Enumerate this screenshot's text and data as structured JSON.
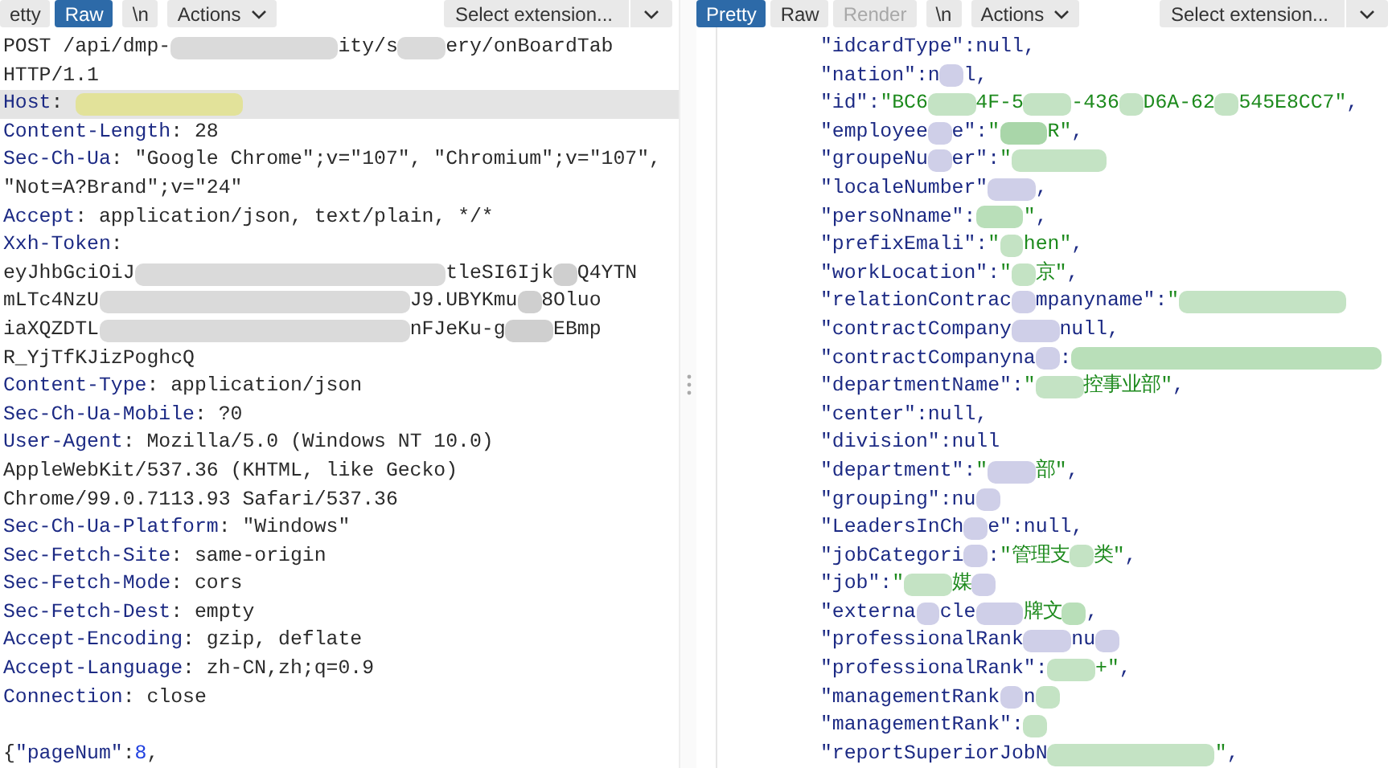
{
  "request": {
    "toolbar": [
      {
        "kind": "tab",
        "label": "etty",
        "selected": false,
        "disabled": false
      },
      {
        "kind": "tab",
        "label": "Raw",
        "selected": true,
        "disabled": false
      },
      {
        "kind": "toggle",
        "label": "\\n"
      },
      {
        "kind": "menu",
        "label": "Actions"
      }
    ],
    "extension_select": {
      "placeholder": "Select extension..."
    },
    "lines": [
      {
        "highlighted": false,
        "parts": [
          {
            "kind": "text",
            "text": "POST /api/dmp-"
          },
          {
            "kind": "blur_xl",
            "color": "#dadada"
          },
          {
            "kind": "text",
            "text": "ity/s"
          },
          {
            "kind": "blur_m",
            "color": "#dadada"
          },
          {
            "kind": "text",
            "text": "ery/onBoardTab"
          }
        ]
      },
      {
        "highlighted": false,
        "parts": [
          {
            "kind": "text",
            "text": "HTTP/1.1"
          }
        ]
      },
      {
        "highlighted": true,
        "parts": [
          {
            "kind": "name",
            "text": "Host"
          },
          {
            "kind": "text",
            "text": ": "
          },
          {
            "kind": "blur_xl",
            "color": "#e2e29a"
          }
        ]
      },
      {
        "highlighted": false,
        "parts": [
          {
            "kind": "name",
            "text": "Content-Length"
          },
          {
            "kind": "text",
            "text": ": 28"
          }
        ]
      },
      {
        "highlighted": false,
        "parts": [
          {
            "kind": "name",
            "text": "Sec-Ch-Ua"
          },
          {
            "kind": "text",
            "text": ": \"Google Chrome\";v=\"107\", \"Chromium\";v=\"107\","
          }
        ]
      },
      {
        "highlighted": false,
        "parts": [
          {
            "kind": "text",
            "text": "\"Not=A?Brand\";v=\"24\""
          }
        ]
      },
      {
        "highlighted": false,
        "parts": [
          {
            "kind": "name",
            "text": "Accept"
          },
          {
            "kind": "text",
            "text": ": application/json, text/plain, */*"
          }
        ]
      },
      {
        "highlighted": false,
        "parts": [
          {
            "kind": "name",
            "text": "Xxh-Token"
          },
          {
            "kind": "text",
            "text": ":"
          }
        ]
      },
      {
        "highlighted": false,
        "parts": [
          {
            "kind": "text",
            "text": "eyJhbGciOiJ"
          },
          {
            "kind": "blur_xxl",
            "color": "#dadada"
          },
          {
            "kind": "text",
            "text": "tleSI6Ijk"
          },
          {
            "kind": "blur_s",
            "color": "#cfcfcf"
          },
          {
            "kind": "text",
            "text": "Q4YTN"
          }
        ]
      },
      {
        "highlighted": false,
        "parts": [
          {
            "kind": "text",
            "text": "mLTc4NzU"
          },
          {
            "kind": "blur_xxl",
            "color": "#dadada"
          },
          {
            "kind": "text",
            "text": "J9.UBYKmu"
          },
          {
            "kind": "blur_s",
            "color": "#cfcfcf"
          },
          {
            "kind": "text",
            "text": "8Oluo"
          }
        ]
      },
      {
        "highlighted": false,
        "parts": [
          {
            "kind": "text",
            "text": "iaXQZDTL"
          },
          {
            "kind": "blur_xxl",
            "color": "#dadada"
          },
          {
            "kind": "text",
            "text": "nFJeKu-g"
          },
          {
            "kind": "blur_m",
            "color": "#cfcfcf"
          },
          {
            "kind": "text",
            "text": "EBmp"
          }
        ]
      },
      {
        "highlighted": false,
        "parts": [
          {
            "kind": "text",
            "text": "R_YjTfKJizPoghcQ"
          }
        ]
      },
      {
        "highlighted": false,
        "parts": [
          {
            "kind": "name",
            "text": "Content-Type"
          },
          {
            "kind": "text",
            "text": ": application/json"
          }
        ]
      },
      {
        "highlighted": false,
        "parts": [
          {
            "kind": "name",
            "text": "Sec-Ch-Ua-Mobile"
          },
          {
            "kind": "text",
            "text": ": ?0"
          }
        ]
      },
      {
        "highlighted": false,
        "parts": [
          {
            "kind": "name",
            "text": "User-Agent"
          },
          {
            "kind": "text",
            "text": ": Mozilla/5.0 (Windows NT 10.0)"
          }
        ]
      },
      {
        "highlighted": false,
        "parts": [
          {
            "kind": "text",
            "text": "AppleWebKit/537.36 (KHTML, like Gecko)"
          }
        ]
      },
      {
        "highlighted": false,
        "parts": [
          {
            "kind": "text",
            "text": "Chrome/99.0.7113.93 Safari/537.36"
          }
        ]
      },
      {
        "highlighted": false,
        "parts": [
          {
            "kind": "name",
            "text": "Sec-Ch-Ua-Platform"
          },
          {
            "kind": "text",
            "text": ": \"Windows\""
          }
        ]
      },
      {
        "highlighted": false,
        "parts": [
          {
            "kind": "name",
            "text": "Sec-Fetch-Site"
          },
          {
            "kind": "text",
            "text": ": same-origin"
          }
        ]
      },
      {
        "highlighted": false,
        "parts": [
          {
            "kind": "name",
            "text": "Sec-Fetch-Mode"
          },
          {
            "kind": "text",
            "text": ": cors"
          }
        ]
      },
      {
        "highlighted": false,
        "parts": [
          {
            "kind": "name",
            "text": "Sec-Fetch-Dest"
          },
          {
            "kind": "text",
            "text": ": empty"
          }
        ]
      },
      {
        "highlighted": false,
        "parts": [
          {
            "kind": "name",
            "text": "Accept-Encoding"
          },
          {
            "kind": "text",
            "text": ": gzip, deflate"
          }
        ]
      },
      {
        "highlighted": false,
        "parts": [
          {
            "kind": "name",
            "text": "Accept-Language"
          },
          {
            "kind": "text",
            "text": ": zh-CN,zh;q=0.9"
          }
        ]
      },
      {
        "highlighted": false,
        "parts": [
          {
            "kind": "name",
            "text": "Connection"
          },
          {
            "kind": "text",
            "text": ": close"
          }
        ]
      },
      {
        "highlighted": false
      },
      {
        "highlighted": false,
        "parts": [
          {
            "kind": "text",
            "text": "{"
          },
          {
            "kind": "str",
            "text": "\"pageNum\""
          },
          {
            "kind": "text",
            "text": ":"
          },
          {
            "kind": "num",
            "text": "8"
          },
          {
            "kind": "text",
            "text": ","
          }
        ]
      }
    ]
  },
  "response": {
    "toolbar": [
      {
        "kind": "tab",
        "label": "Pretty",
        "selected": true,
        "disabled": false
      },
      {
        "kind": "tab",
        "label": "Raw",
        "selected": false,
        "disabled": false
      },
      {
        "kind": "tab",
        "label": "Render",
        "selected": false,
        "disabled": true
      },
      {
        "kind": "toggle",
        "label": "\\n"
      },
      {
        "kind": "menu",
        "label": "Actions"
      }
    ],
    "extension_select": {
      "placeholder": "Select extension..."
    },
    "lines": [
      {
        "parts": [
          {
            "kind": "name",
            "text": "\"idcardType\":null,"
          }
        ]
      },
      {
        "parts": [
          {
            "kind": "name",
            "text": "\"nation\":n"
          },
          {
            "kind": "blur_s",
            "color": "#cfcfe8"
          },
          {
            "kind": "name",
            "text": "l,"
          }
        ]
      },
      {
        "parts": [
          {
            "kind": "name",
            "text": "\"id\":"
          },
          {
            "kind": "str",
            "text": "\"BC6"
          },
          {
            "kind": "blur_m",
            "color": "#c4e3c4"
          },
          {
            "kind": "str",
            "text": "4F-5"
          },
          {
            "kind": "blur_m",
            "color": "#c4e3c4"
          },
          {
            "kind": "str",
            "text": "-436"
          },
          {
            "kind": "blur_s",
            "color": "#c4e3c4"
          },
          {
            "kind": "str",
            "text": "D6A-62"
          },
          {
            "kind": "blur_s",
            "color": "#c4e3c4"
          },
          {
            "kind": "str",
            "text": "545E8CC7\""
          },
          {
            "kind": "name",
            "text": ","
          }
        ]
      },
      {
        "parts": [
          {
            "kind": "name",
            "text": "\"employee"
          },
          {
            "kind": "blur_s",
            "color": "#cfcfe8"
          },
          {
            "kind": "name",
            "text": "e\":"
          },
          {
            "kind": "str",
            "text": "\""
          },
          {
            "kind": "blur_m",
            "color": "#a9d6a9"
          },
          {
            "kind": "str",
            "text": "R\""
          },
          {
            "kind": "name",
            "text": ","
          }
        ]
      },
      {
        "parts": [
          {
            "kind": "name",
            "text": "\"groupeNu"
          },
          {
            "kind": "blur_s",
            "color": "#cfcfe8"
          },
          {
            "kind": "name",
            "text": "er\":"
          },
          {
            "kind": "str",
            "text": "\""
          },
          {
            "kind": "blur_l",
            "color": "#c4e3c4"
          }
        ]
      },
      {
        "parts": [
          {
            "kind": "name",
            "text": "\"localeNumber\""
          },
          {
            "kind": "blur_m",
            "color": "#cfcfe8"
          },
          {
            "kind": "name",
            "text": ","
          }
        ]
      },
      {
        "parts": [
          {
            "kind": "name",
            "text": "\"persoNname\":"
          },
          {
            "kind": "blur_m",
            "color": "#b9dfb9"
          },
          {
            "kind": "str",
            "text": "\""
          },
          {
            "kind": "name",
            "text": ","
          }
        ]
      },
      {
        "parts": [
          {
            "kind": "name",
            "text": "\"prefixEmali\":"
          },
          {
            "kind": "str",
            "text": "\""
          },
          {
            "kind": "blur_s",
            "color": "#c4e3c4"
          },
          {
            "kind": "str",
            "text": "hen\""
          },
          {
            "kind": "name",
            "text": ","
          }
        ]
      },
      {
        "parts": [
          {
            "kind": "name",
            "text": "\"workLocation\":"
          },
          {
            "kind": "str",
            "text": "\""
          },
          {
            "kind": "blur_s",
            "color": "#c4e3c4"
          },
          {
            "kind": "str",
            "text": "京\""
          },
          {
            "kind": "name",
            "text": ","
          }
        ]
      },
      {
        "parts": [
          {
            "kind": "name",
            "text": "\"relationContrac"
          },
          {
            "kind": "blur_s",
            "color": "#cfcfe8"
          },
          {
            "kind": "name",
            "text": "mpanyname\":"
          },
          {
            "kind": "str",
            "text": "\""
          },
          {
            "kind": "blur_xl",
            "color": "#c4e3c4"
          }
        ]
      },
      {
        "parts": [
          {
            "kind": "name",
            "text": "\"contractCompany"
          },
          {
            "kind": "blur_m",
            "color": "#cfcfe8"
          },
          {
            "kind": "name",
            "text": "null,"
          }
        ]
      },
      {
        "parts": [
          {
            "kind": "name",
            "text": "\"contractCompanyna"
          },
          {
            "kind": "blur_s",
            "color": "#cfcfe8"
          },
          {
            "kind": "name",
            "text": ":"
          },
          {
            "kind": "blur_xxl",
            "color": "#b9dfb9"
          }
        ]
      },
      {
        "parts": [
          {
            "kind": "name",
            "text": "\"departmentName\":"
          },
          {
            "kind": "str",
            "text": "\""
          },
          {
            "kind": "blur_m",
            "color": "#c4e3c4"
          },
          {
            "kind": "str",
            "text": "控事业部\""
          },
          {
            "kind": "name",
            "text": ","
          }
        ]
      },
      {
        "parts": [
          {
            "kind": "name",
            "text": "\"center\":null,"
          }
        ]
      },
      {
        "parts": [
          {
            "kind": "name",
            "text": "\"division\":null"
          }
        ]
      },
      {
        "parts": [
          {
            "kind": "name",
            "text": "\"department\":"
          },
          {
            "kind": "str",
            "text": "\""
          },
          {
            "kind": "blur_m",
            "color": "#cfcfe8"
          },
          {
            "kind": "str",
            "text": "部\""
          },
          {
            "kind": "name",
            "text": ","
          }
        ]
      },
      {
        "parts": [
          {
            "kind": "name",
            "text": "\"grouping\":nu"
          },
          {
            "kind": "blur_s",
            "color": "#cfcfe8"
          }
        ]
      },
      {
        "parts": [
          {
            "kind": "name",
            "text": "\"LeadersInCh"
          },
          {
            "kind": "blur_s",
            "color": "#cfcfe8"
          },
          {
            "kind": "name",
            "text": "e\":null,"
          }
        ]
      },
      {
        "parts": [
          {
            "kind": "name",
            "text": "\"jobCategori"
          },
          {
            "kind": "blur_s",
            "color": "#cfcfe8"
          },
          {
            "kind": "name",
            "text": ":"
          },
          {
            "kind": "str",
            "text": "\"管理支"
          },
          {
            "kind": "blur_s",
            "color": "#c4e3c4"
          },
          {
            "kind": "str",
            "text": "类\""
          },
          {
            "kind": "name",
            "text": ","
          }
        ]
      },
      {
        "parts": [
          {
            "kind": "name",
            "text": "\"job\":"
          },
          {
            "kind": "str",
            "text": "\""
          },
          {
            "kind": "blur_m",
            "color": "#c4e3c4"
          },
          {
            "kind": "str",
            "text": "媒"
          },
          {
            "kind": "blur_s",
            "color": "#cfcfe8"
          }
        ]
      },
      {
        "parts": [
          {
            "kind": "name",
            "text": "\"externa"
          },
          {
            "kind": "blur_s",
            "color": "#cfcfe8"
          },
          {
            "kind": "name",
            "text": "cle"
          },
          {
            "kind": "blur_m",
            "color": "#cfcfe8"
          },
          {
            "kind": "str",
            "text": "牌文"
          },
          {
            "kind": "blur_s",
            "color": "#b9dfb9"
          },
          {
            "kind": "name",
            "text": ","
          }
        ]
      },
      {
        "parts": [
          {
            "kind": "name",
            "text": "\"professionalRank"
          },
          {
            "kind": "blur_m",
            "color": "#cfcfe8"
          },
          {
            "kind": "name",
            "text": "nu"
          },
          {
            "kind": "blur_s",
            "color": "#cfcfe8"
          }
        ]
      },
      {
        "parts": [
          {
            "kind": "name",
            "text": "\"professionalRank\":"
          },
          {
            "kind": "blur_m",
            "color": "#c4e3c4"
          },
          {
            "kind": "str",
            "text": "+\""
          },
          {
            "kind": "name",
            "text": ","
          }
        ]
      },
      {
        "parts": [
          {
            "kind": "name",
            "text": "\"managementRank"
          },
          {
            "kind": "blur_s",
            "color": "#cfcfe8"
          },
          {
            "kind": "name",
            "text": "n"
          },
          {
            "kind": "blur_s",
            "color": "#c4e3c4"
          }
        ]
      },
      {
        "parts": [
          {
            "kind": "name",
            "text": "\"managementRank\":"
          },
          {
            "kind": "blur_s",
            "color": "#c4e3c4"
          }
        ]
      },
      {
        "parts": [
          {
            "kind": "name",
            "text": "\"reportSuperiorJobN"
          },
          {
            "kind": "blur_xl",
            "color": "#c4e3c4"
          },
          {
            "kind": "str",
            "text": "\""
          },
          {
            "kind": "name",
            "text": ","
          }
        ]
      }
    ]
  }
}
